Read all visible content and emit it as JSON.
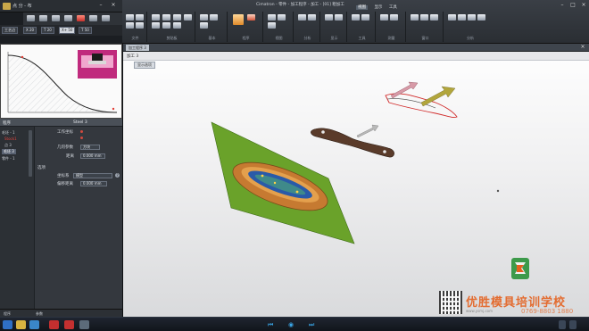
{
  "window": {
    "left_title": "点 分 - 布",
    "main_title": "Cimatron - 零件 - 加工程序 - 加工 - [01] 粗加工"
  },
  "left_tabs": [
    {
      "label": "工艺边",
      "active": false
    },
    {
      "label": "X 20",
      "active": false
    },
    {
      "label": "T 20",
      "active": false
    },
    {
      "label": "X+ 50",
      "active": true
    },
    {
      "label": "T 50",
      "active": false
    }
  ],
  "ribbon": {
    "menu_tabs": [
      "视图",
      "显示",
      "工具"
    ],
    "active_menu_tab": "视图",
    "groups": [
      "文件",
      "剪贴板",
      "基本",
      "程序",
      "视图",
      "分析",
      "显示",
      "工具",
      "测量",
      "窗口",
      "分析"
    ]
  },
  "panel": {
    "header_left": "程序",
    "header_right": "Steel 3",
    "tree": [
      {
        "label": "毛坯 - 1",
        "selected": false
      },
      {
        "label": "Stock1",
        "selected": false
      },
      {
        "label": "点 3",
        "selected": false
      },
      {
        "label": "毛坯 3",
        "selected": true
      },
      {
        "label": "零件 - 1",
        "selected": false
      },
      {
        "label": "",
        "selected": false
      }
    ],
    "props": {
      "row1_label": "工作坐标",
      "row2_label": "几何参数",
      "row2_value": "方块",
      "row3_label": "距离",
      "row3_value": "0.000 mm",
      "section": "选项",
      "row4_label": "坐标系",
      "row4_value": "模型",
      "row5_label": "偏移距离",
      "row5_value": "0.000 mm"
    },
    "bottom_tabs": [
      "程序",
      "参数"
    ]
  },
  "viewport": {
    "tab": "加工程序 3",
    "sub_label": "加工 3",
    "option_label": "显示选项"
  },
  "watermark": {
    "name": "优胜模具培训学校",
    "url": "www.ysmj.com",
    "phone": "0769-8803 1880"
  },
  "colors": {
    "accent": "#e4601e",
    "plane": "#6aa22a",
    "part": "#d38a3c",
    "taskbar": "#161b22"
  }
}
